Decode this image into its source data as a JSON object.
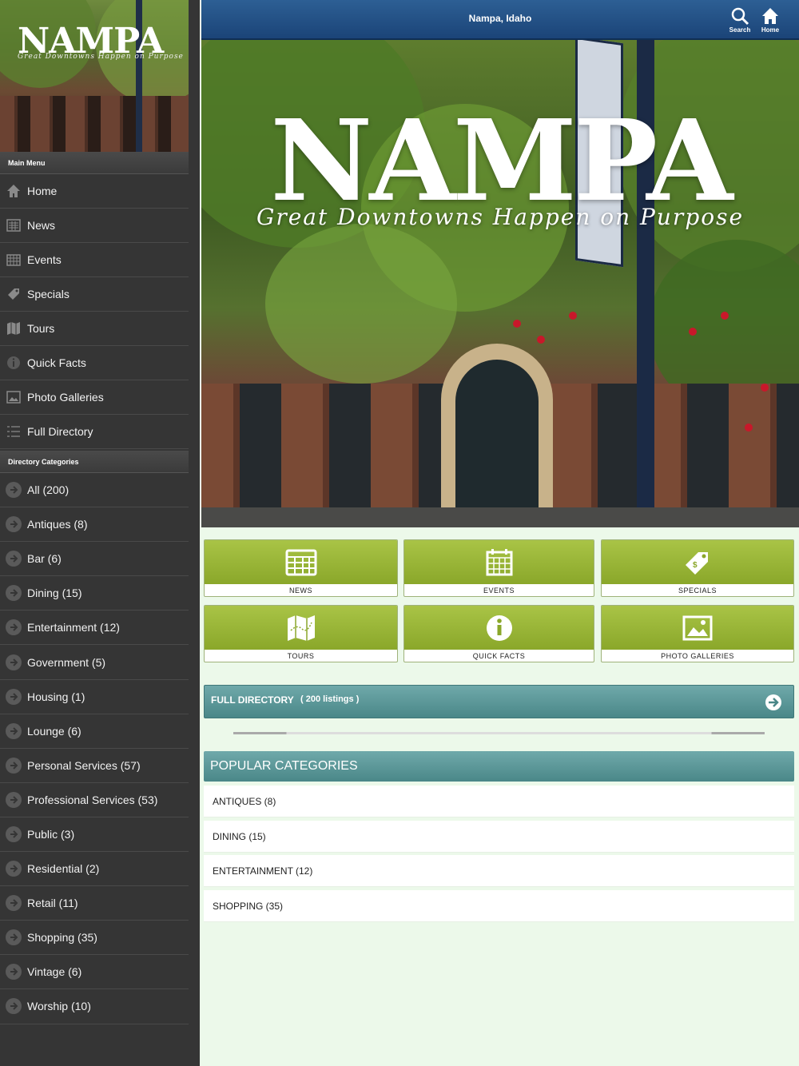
{
  "sidebar": {
    "logo": "NAMPA",
    "tagline": "Great Downtowns Happen on Purpose",
    "main_menu_title": "Main Menu",
    "main_menu": [
      {
        "label": "Home",
        "icon": "home-icon"
      },
      {
        "label": "News",
        "icon": "newspaper-icon"
      },
      {
        "label": "Events",
        "icon": "calendar-icon"
      },
      {
        "label": "Specials",
        "icon": "tag-icon"
      },
      {
        "label": "Tours",
        "icon": "map-icon"
      },
      {
        "label": "Quick Facts",
        "icon": "info-icon"
      },
      {
        "label": "Photo Galleries",
        "icon": "image-icon"
      },
      {
        "label": "Full Directory",
        "icon": "list-icon"
      }
    ],
    "categories_title": "Directory Categories",
    "categories": [
      {
        "label": "All (200)"
      },
      {
        "label": "Antiques (8)"
      },
      {
        "label": "Bar (6)"
      },
      {
        "label": "Dining (15)"
      },
      {
        "label": "Entertainment (12)"
      },
      {
        "label": "Government (5)"
      },
      {
        "label": "Housing (1)"
      },
      {
        "label": "Lounge (6)"
      },
      {
        "label": "Personal Services (57)"
      },
      {
        "label": "Professional Services (53)"
      },
      {
        "label": "Public (3)"
      },
      {
        "label": "Residential (2)"
      },
      {
        "label": "Retail (11)"
      },
      {
        "label": "Shopping (35)"
      },
      {
        "label": "Vintage (6)"
      },
      {
        "label": "Worship (10)"
      }
    ]
  },
  "topbar": {
    "title": "Nampa, Idaho",
    "search_label": "Search",
    "home_label": "Home"
  },
  "hero": {
    "title": "NAMPA",
    "tagline": "Great Downtowns Happen on Purpose"
  },
  "tiles": [
    {
      "label": "NEWS",
      "icon": "newspaper-icon"
    },
    {
      "label": "EVENTS",
      "icon": "calendar-icon"
    },
    {
      "label": "SPECIALS",
      "icon": "tag-icon"
    },
    {
      "label": "TOURS",
      "icon": "map-icon"
    },
    {
      "label": "QUICK FACTS",
      "icon": "info-icon"
    },
    {
      "label": "PHOTO GALLERIES",
      "icon": "image-icon"
    }
  ],
  "full_directory": {
    "label": "FULL DIRECTORY",
    "count": "( 200 listings )"
  },
  "popular": {
    "title": "POPULAR CATEGORIES",
    "items": [
      {
        "label": "ANTIQUES (8)"
      },
      {
        "label": "DINING (15)"
      },
      {
        "label": "ENTERTAINMENT (12)"
      },
      {
        "label": "SHOPPING (35)"
      }
    ]
  },
  "colors": {
    "topbar": "#1b4478",
    "sidebar": "#353535",
    "tile_green": "#98b53a",
    "teal_bar": "#5a9697",
    "page_bg": "#ecf9ea"
  }
}
